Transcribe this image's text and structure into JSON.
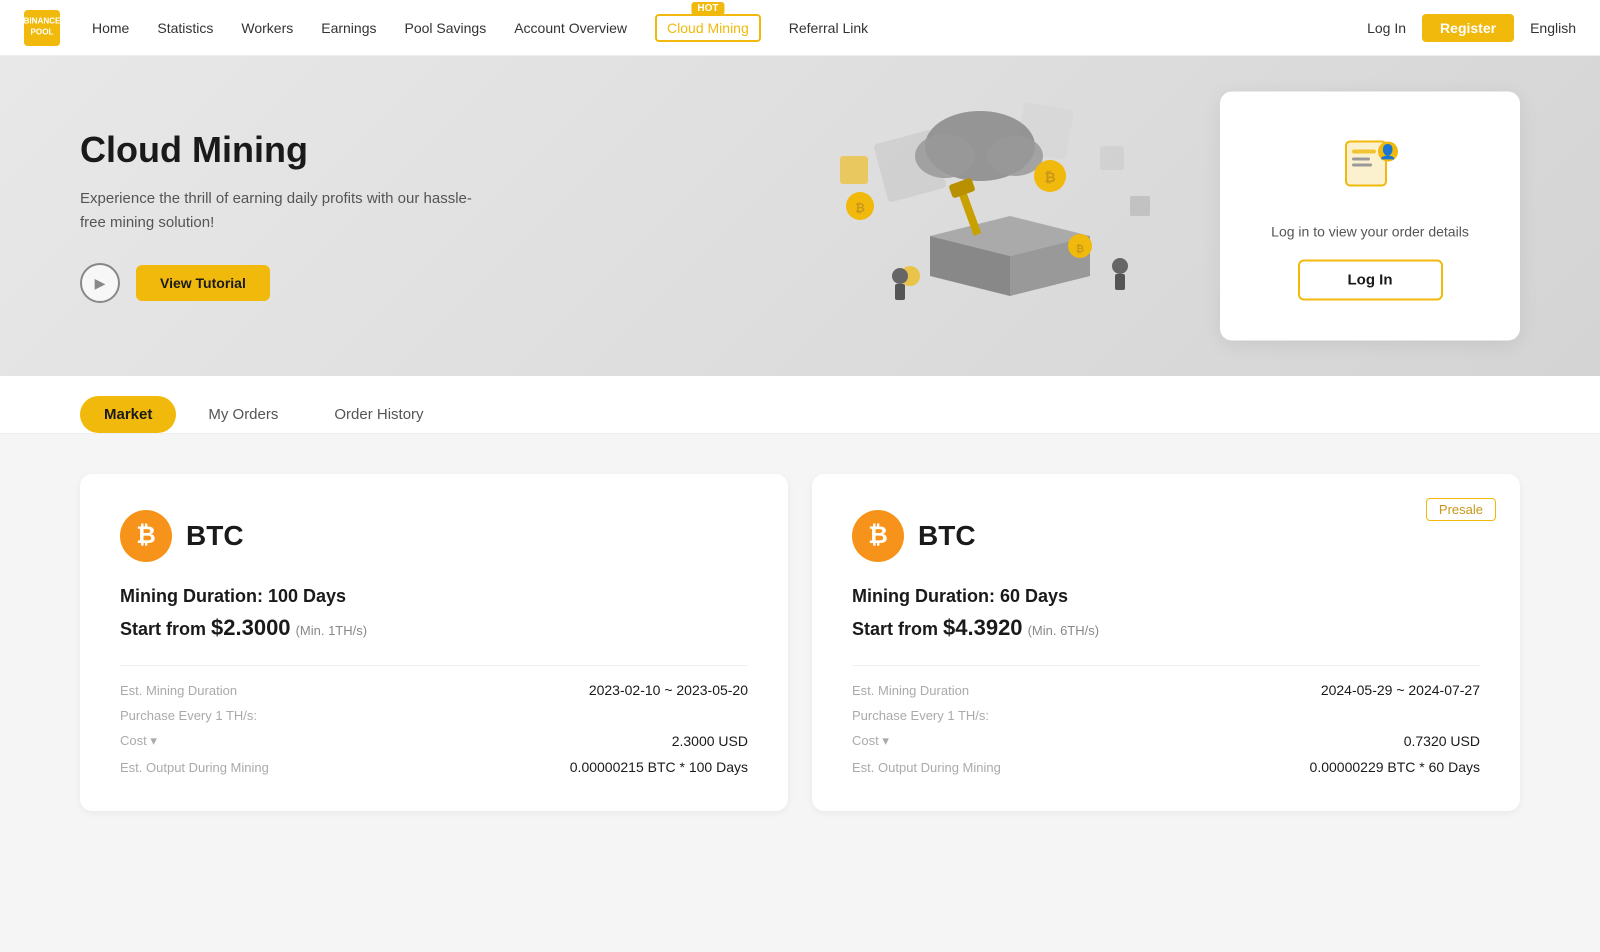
{
  "navbar": {
    "logo_text": "BINANCE\nPOOL",
    "links": [
      {
        "id": "home",
        "label": "Home"
      },
      {
        "id": "statistics",
        "label": "Statistics"
      },
      {
        "id": "workers",
        "label": "Workers"
      },
      {
        "id": "earnings",
        "label": "Earnings"
      },
      {
        "id": "pool-savings",
        "label": "Pool Savings"
      },
      {
        "id": "account-overview",
        "label": "Account Overview"
      },
      {
        "id": "cloud-mining",
        "label": "Cloud Mining",
        "hot": true,
        "active": true
      },
      {
        "id": "referral-link",
        "label": "Referral Link"
      }
    ],
    "login_label": "Log In",
    "register_label": "Register",
    "language": "English"
  },
  "hero": {
    "title": "Cloud Mining",
    "description": "Experience the thrill of earning daily profits with our hassle-free mining solution!",
    "play_label": "▶",
    "tutorial_label": "View Tutorial",
    "login_card": {
      "icon": "🗂️",
      "text": "Log in to view your order details",
      "login_label": "Log In"
    }
  },
  "tabs": [
    {
      "id": "market",
      "label": "Market",
      "active": true
    },
    {
      "id": "my-orders",
      "label": "My Orders"
    },
    {
      "id": "order-history",
      "label": "Order History"
    }
  ],
  "cards": [
    {
      "id": "card-1",
      "coin": "BTC",
      "presale": false,
      "duration_label": "Mining Duration: 100 Days",
      "price_from": "$2.3000",
      "price_min": "(Min. 1TH/s)",
      "details": {
        "est_duration_label": "Est. Mining Duration",
        "est_duration_value": "2023-02-10 ~ 2023-05-20",
        "purchase_label": "Purchase Every 1 TH/s:",
        "cost_label": "Cost ▾",
        "cost_value": "2.3000 USD",
        "output_label": "Est. Output During Mining",
        "output_value": "0.00000215 BTC * 100 Days"
      }
    },
    {
      "id": "card-2",
      "coin": "BTC",
      "presale": true,
      "presale_label": "Presale",
      "duration_label": "Mining Duration: 60 Days",
      "price_from": "$4.3920",
      "price_min": "(Min. 6TH/s)",
      "details": {
        "est_duration_label": "Est. Mining Duration",
        "est_duration_value": "2024-05-29 ~ 2024-07-27",
        "purchase_label": "Purchase Every 1 TH/s:",
        "cost_label": "Cost ▾",
        "cost_value": "0.7320 USD",
        "output_label": "Est. Output During Mining",
        "output_value": "0.00000229 BTC * 60 Days"
      }
    }
  ]
}
